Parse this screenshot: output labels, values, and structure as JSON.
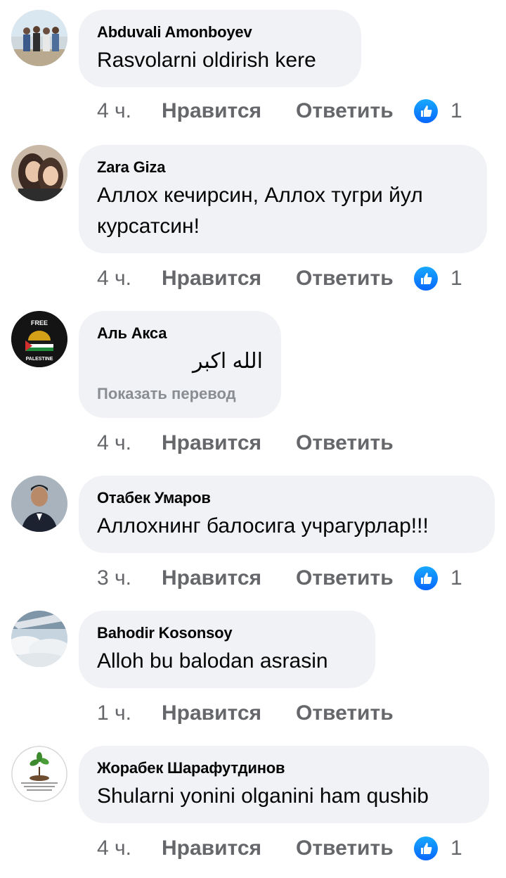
{
  "comments": [
    {
      "author": "Abduvali Amonboyev",
      "text": "Rasvolarni oldirish kere",
      "time": "4 ч.",
      "like_label": "Нравится",
      "reply_label": "Ответить",
      "reactions": "1"
    },
    {
      "author": "Zara Giza",
      "text": "Аллох кечирсин, Аллох тугри йул курсатсин!",
      "time": "4 ч.",
      "like_label": "Нравится",
      "reply_label": "Ответить",
      "reactions": "1"
    },
    {
      "author": "Аль Акса",
      "text": "الله اكبر",
      "translate_label": "Показать перевод",
      "avatar_text_top": "FREE",
      "avatar_text_bottom": "PALESTINE",
      "time": "4 ч.",
      "like_label": "Нравится",
      "reply_label": "Ответить"
    },
    {
      "author": "Отабек Умаров",
      "text": "Аллохнинг балосига учрагурлар!!!",
      "time": "3 ч.",
      "like_label": "Нравится",
      "reply_label": "Ответить",
      "reactions": "1"
    },
    {
      "author": "Bahodir Kosonsoy",
      "text": "Alloh bu balodan asrasin",
      "time": "1 ч.",
      "like_label": "Нравится",
      "reply_label": "Ответить"
    },
    {
      "author": "Жорабек Шарафутдинов",
      "text": "Shularni yonini olganini ham qushib",
      "time": "4 ч.",
      "like_label": "Нравится",
      "reply_label": "Ответить",
      "reactions": "1"
    }
  ],
  "colors": {
    "bubble": "#f0f2f5",
    "meta_text": "#65676b",
    "like_blue": "#0866ff"
  }
}
